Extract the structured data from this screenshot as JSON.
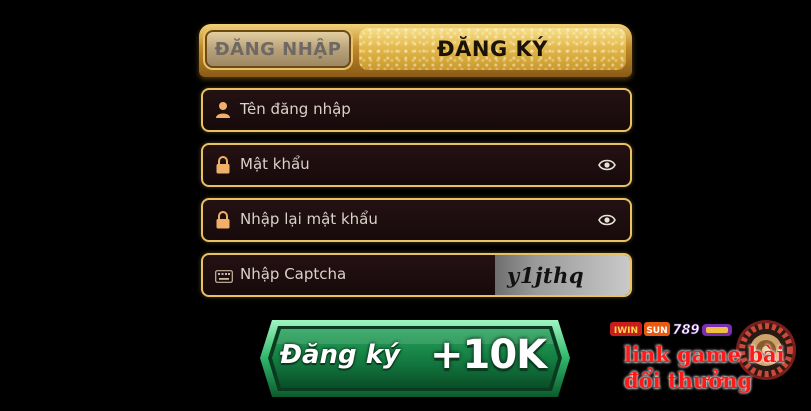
{
  "tabs": {
    "login_label": "ĐĂNG NHẬP",
    "register_label": "ĐĂNG KÝ",
    "active": "register"
  },
  "form": {
    "username": {
      "placeholder": "Tên đăng nhập",
      "icon": "user-icon"
    },
    "password": {
      "placeholder": "Mật khẩu",
      "icon": "lock-icon",
      "toggle_icon": "eye-icon"
    },
    "confirm_password": {
      "placeholder": "Nhập lại mật khẩu",
      "icon": "lock-icon",
      "toggle_icon": "eye-icon"
    },
    "captcha": {
      "placeholder": "Nhập Captcha",
      "icon": "keyboard-icon",
      "code": "y1jthq"
    }
  },
  "register_button": {
    "label": "Đăng ký",
    "bonus": "+10K"
  },
  "watermark": {
    "line1": "link game bài",
    "line2": "đổi thưởng",
    "logos": [
      "IWIN",
      "SUN",
      "789"
    ]
  },
  "colors": {
    "gold": "#e7c162",
    "field_bg": "#1c0d0e",
    "button_green": "#1f8a4c",
    "watermark_red": "#ff1a1a"
  }
}
